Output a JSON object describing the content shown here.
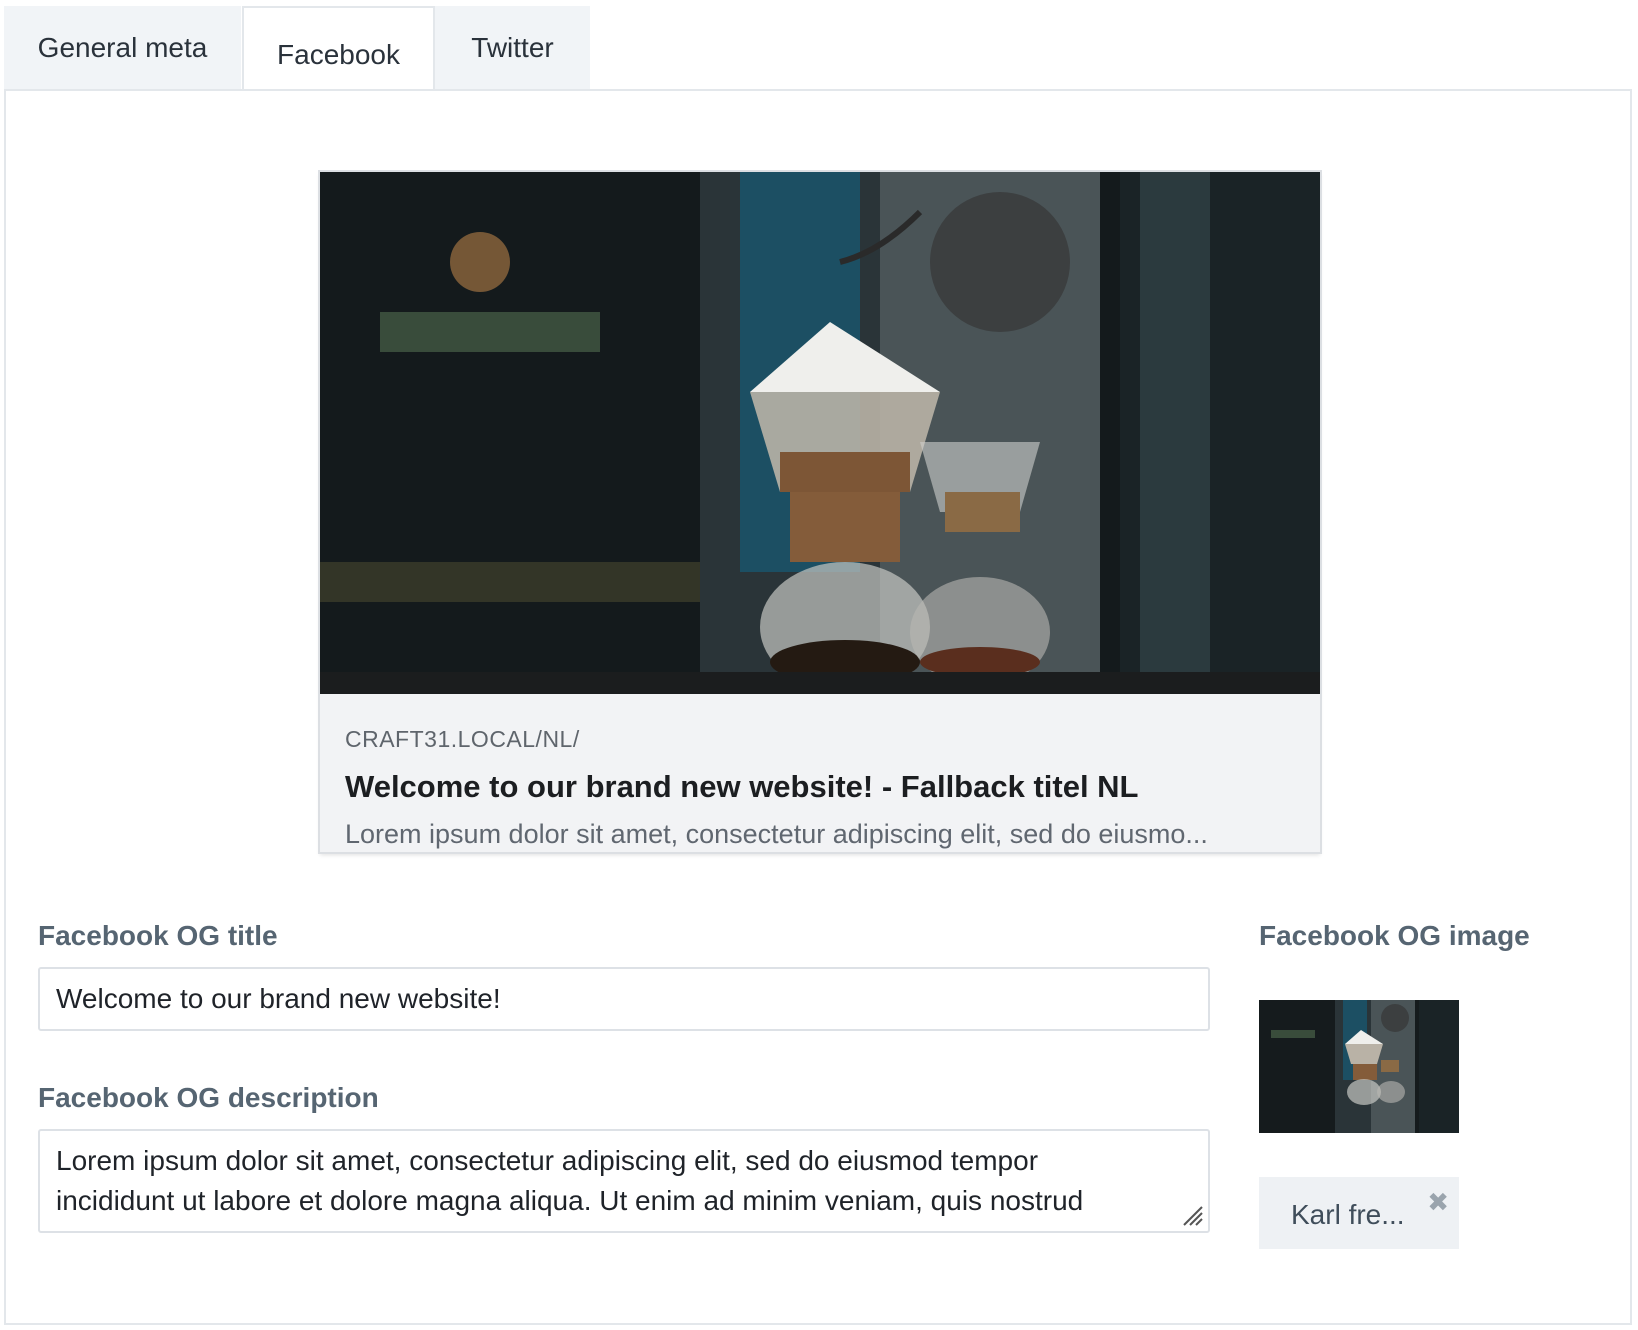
{
  "tabs": [
    {
      "label": "General meta"
    },
    {
      "label": "Facebook"
    },
    {
      "label": "Twitter"
    }
  ],
  "active_tab": "Facebook",
  "preview": {
    "domain": "CRAFT31.LOCAL/NL/",
    "title": "Welcome to our brand new website! - Fallback titel NL",
    "description": "Lorem ipsum dolor sit amet, consectetur adipiscing elit, sed do eiusmo..."
  },
  "fields": {
    "og_title_label": "Facebook OG title",
    "og_title_value": "Welcome to our brand new website!",
    "og_description_label": "Facebook OG description",
    "og_description_line1": "Lorem ipsum dolor sit amet, consectetur adipiscing elit, sed do eiusmod tempor",
    "og_description_line2": "incididunt ut labore et dolore magna aliqua. Ut enim ad minim veniam, quis nostrud",
    "og_image_label": "Facebook OG image",
    "og_image_chip": "Karl fre..."
  },
  "colors": {
    "tab_bg": "#f1f4f7",
    "label": "#566572",
    "border": "#dde1e6"
  }
}
